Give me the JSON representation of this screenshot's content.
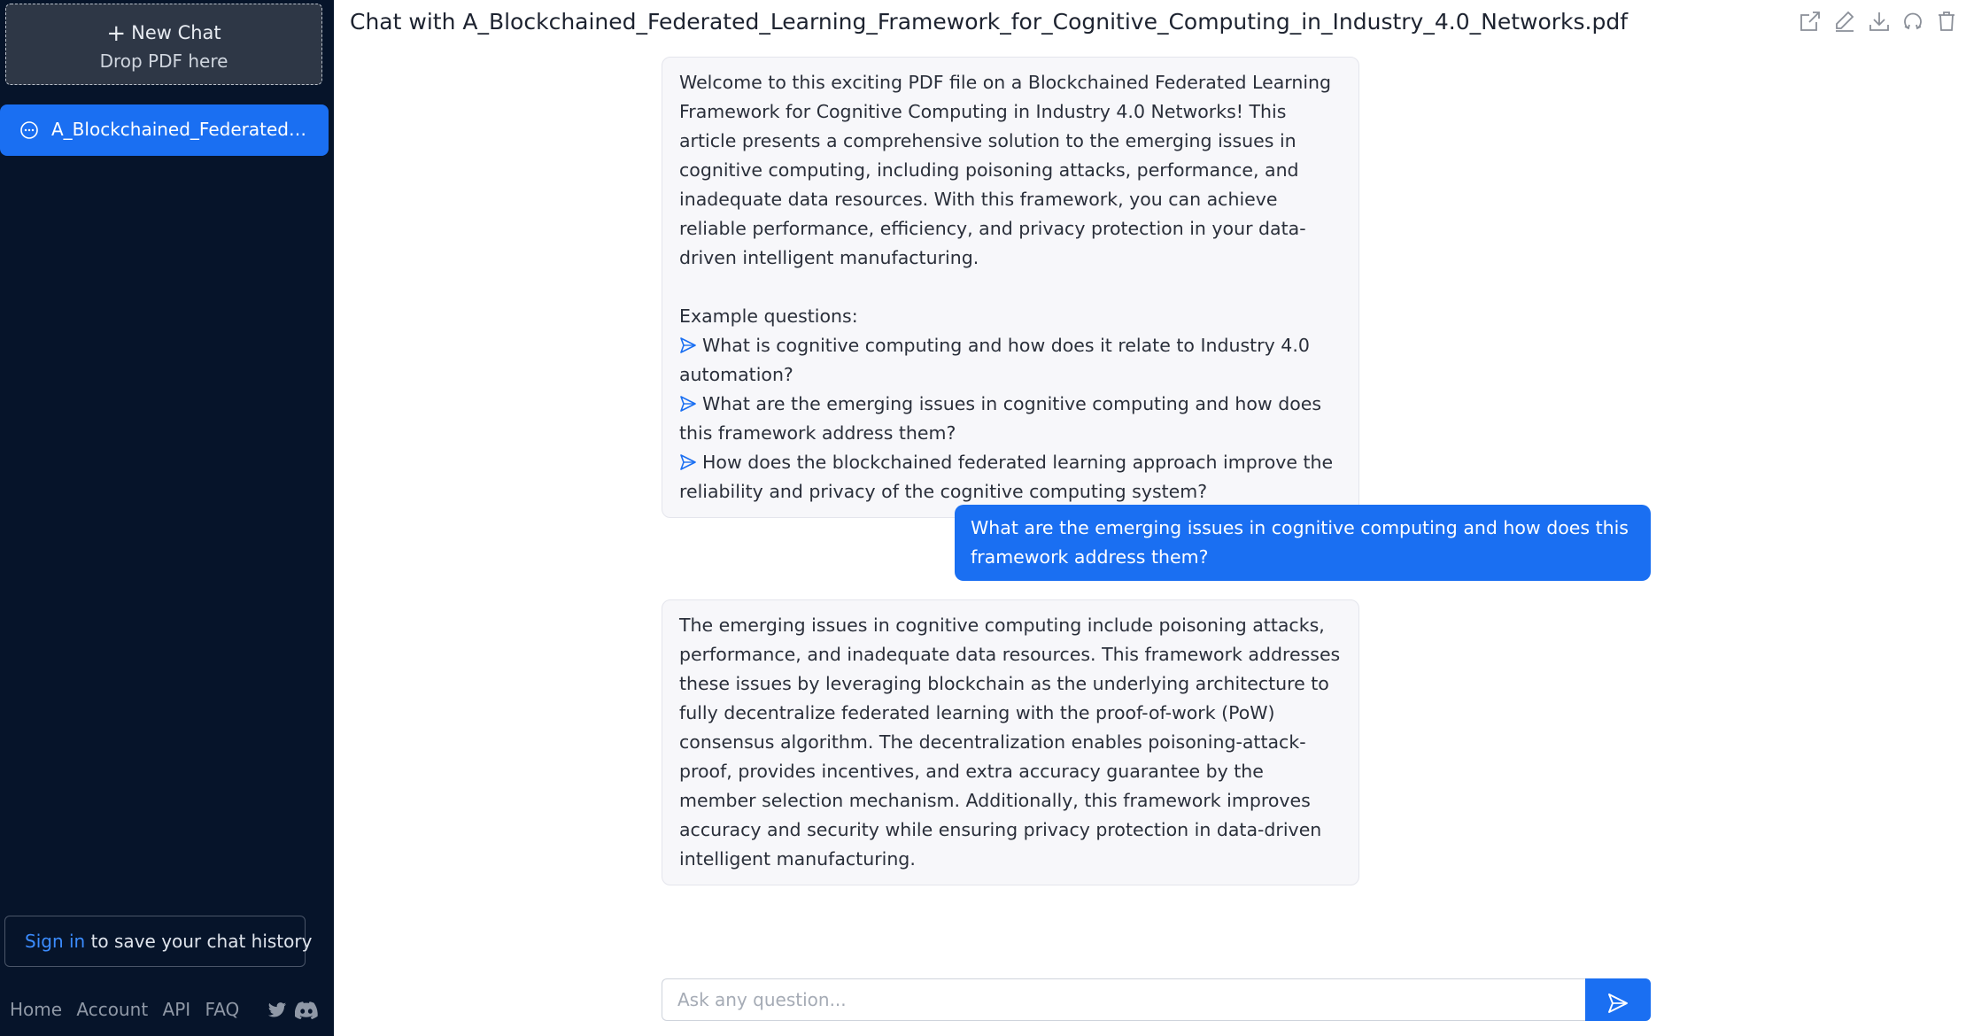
{
  "sidebar": {
    "new_chat_label": "New Chat",
    "drop_label": "Drop PDF here",
    "chats": [
      {
        "label": "A_Blockchained_Federated_Learning_Framework_for_Cognitive_Computing_in_Industry_4.0_Networks.pdf",
        "active": true
      }
    ],
    "signin_link": "Sign in",
    "signin_text": "to save your chat history",
    "footer_links": [
      "Home",
      "Account",
      "API",
      "FAQ"
    ],
    "social_icons": [
      "twitter-icon",
      "discord-icon"
    ]
  },
  "header": {
    "title": "Chat with A_Blockchained_Federated_Learning_Framework_for_Cognitive_Computing_in_Industry_4.0_Networks.pdf",
    "tools": [
      "share-icon",
      "edit-icon",
      "download-icon",
      "refresh-icon",
      "trash-icon"
    ]
  },
  "messages": {
    "welcome": {
      "intro": "Welcome to this exciting PDF file on a Blockchained Federated Learning Framework for Cognitive Computing in Industry 4.0 Networks! This article presents a comprehensive solution to the emerging issues in cognitive computing, including poisoning attacks, performance, and inadequate data resources. With this framework, you can achieve reliable performance, efficiency, and privacy protection in your data-driven intelligent manufacturing.",
      "examples_heading": "Example questions:",
      "examples": [
        "What is cognitive computing and how does it relate to Industry 4.0 automation?",
        "What are the emerging issues in cognitive computing and how does this framework address them?",
        "How does the blockchained federated learning approach improve the reliability and privacy of the cognitive computing system?"
      ]
    },
    "user_question": "What are the emerging issues in cognitive computing and how does this framework address them?",
    "answer": "The emerging issues in cognitive computing include poisoning attacks, performance, and inadequate data resources. This framework addresses these issues by leveraging blockchain as the underlying architecture to fully decentralize federated learning with the proof-of-work (PoW) consensus algorithm. The decentralization enables poisoning-attack-proof, provides incentives, and extra accuracy guarantee by the member selection mechanism. Additionally, this framework improves accuracy and security while ensuring privacy protection in data-driven intelligent manufacturing."
  },
  "composer": {
    "placeholder": "Ask any question...",
    "send_icon": "send-icon"
  },
  "colors": {
    "sidebar_bg": "#06142a",
    "accent": "#1a6ff2",
    "ai_bubble_bg": "#f7f7fa"
  }
}
